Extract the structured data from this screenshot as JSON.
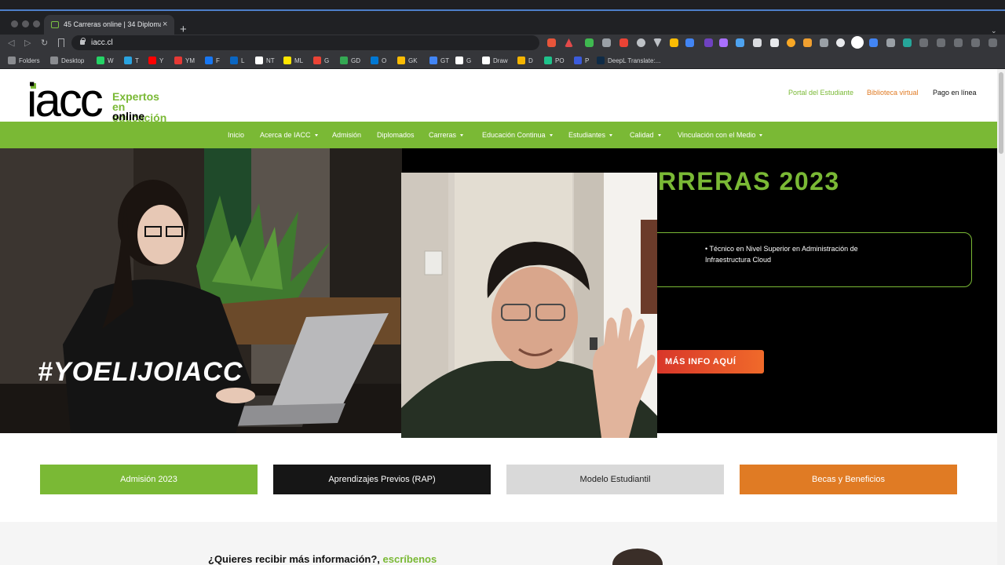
{
  "browser": {
    "tab_title": "45 Carreras online | 34 Diploma",
    "tab_close": "×",
    "new_tab": "+",
    "tab_menu": "⌄",
    "url": "iacc.cl",
    "back": "◁",
    "forward": "▷",
    "reload": "↻",
    "bookmarks": [
      {
        "label": "Folders",
        "color": "#8a8c90"
      },
      {
        "label": "Desktop",
        "color": "#8a8c90"
      },
      {
        "label": "W",
        "color": "#25d366"
      },
      {
        "label": "T",
        "color": "#2aa3df"
      },
      {
        "label": "Y",
        "color": "#ff0000"
      },
      {
        "label": "YM",
        "color": "#e53935"
      },
      {
        "label": "F",
        "color": "#1877f2"
      },
      {
        "label": "L",
        "color": "#0a66c2"
      },
      {
        "label": "NT",
        "color": "#ffffff"
      },
      {
        "label": "ML",
        "color": "#ffe600"
      },
      {
        "label": "G",
        "color": "#ea4335"
      },
      {
        "label": "GD",
        "color": "#34a853"
      },
      {
        "label": "O",
        "color": "#0078d4"
      },
      {
        "label": "GK",
        "color": "#fbbc04"
      },
      {
        "label": "GT",
        "color": "#4285f4"
      },
      {
        "label": "G",
        "color": "#ffffff"
      },
      {
        "label": "Draw",
        "color": "#ffffff"
      },
      {
        "label": "D",
        "color": "#f4b400"
      },
      {
        "label": "PO",
        "color": "#1ec28b"
      },
      {
        "label": "P",
        "color": "#3b5bdb"
      },
      {
        "label": "DeepL Translate:...",
        "color": "#0f2b46"
      }
    ]
  },
  "site": {
    "logo": {
      "wordmark": "iacc",
      "tag_line1": "Expertos",
      "tag_line2": "en educación",
      "tag_line3": "online"
    },
    "top_links": {
      "student_portal": "Portal del Estudiante",
      "library": "Biblioteca virtual",
      "payment": "Pago en línea"
    },
    "menu": [
      {
        "label": "Inicio",
        "dropdown": false
      },
      {
        "label": "Acerca de IACC",
        "dropdown": true
      },
      {
        "label": "Admisión",
        "dropdown": false
      },
      {
        "label": "Diplomados",
        "dropdown": false
      },
      {
        "label": "Carreras",
        "dropdown": true
      },
      {
        "label": "Educación Continua",
        "dropdown": true
      },
      {
        "label": "Estudiantes",
        "dropdown": true
      },
      {
        "label": "Calidad",
        "dropdown": true
      },
      {
        "label": "Vinculación con el Medio",
        "dropdown": true
      }
    ],
    "hero": {
      "hashtag": "#YOELIJOIACC",
      "title": "RRERAS 2023",
      "box_text": "• Técnico en Nivel Superior en Administración de Infraestructura Cloud",
      "cta": "MÁS INFO AQUÍ"
    },
    "buttons": [
      {
        "label": "Admisión 2023",
        "bg": "#7ab935",
        "fg": "#ffffff"
      },
      {
        "label": "Aprendizajes Previos (RAP)",
        "bg": "#161616",
        "fg": "#ffffff"
      },
      {
        "label": "Modelo Estudiantil",
        "bg": "#d9d9d9",
        "fg": "#222222"
      },
      {
        "label": "Becas y Beneficios",
        "bg": "#e07b24",
        "fg": "#ffffff"
      }
    ],
    "info": {
      "question": "¿Quieres recibir más información?,",
      "highlight": "escríbenos"
    }
  },
  "colors": {
    "brand_green": "#7ab935",
    "brand_orange": "#e07b24",
    "link_orange": "#e07b24"
  }
}
